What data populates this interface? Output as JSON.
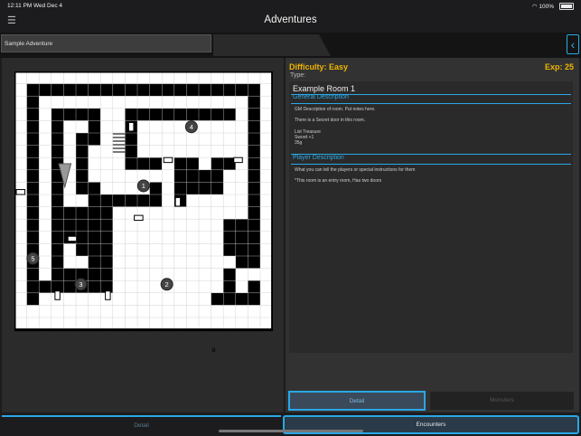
{
  "status": {
    "time": "12:11 PM",
    "date": "Wed Dec 4",
    "battery": "100%"
  },
  "nav": {
    "title": "Adventures",
    "menu_icon": "hamburger-menu-icon",
    "back_icon": "chevron-left-icon"
  },
  "adventure": {
    "name": "Sample Adventure"
  },
  "room": {
    "difficulty": "Difficulty: Easy",
    "exp": "Exp: 25",
    "type": "Type:",
    "name": "Example Room 1",
    "general_heading": "General Description",
    "general_lines": [
      "GM Description of room. Put notes here.",
      "There is a Secret door in this room.",
      "List Treasure",
      "Sword +1",
      "35g"
    ],
    "player_heading": "Player Description",
    "player_lines": [
      "What you can tell the players or special instructions for them",
      "*This room is an entry room, Has two doors"
    ]
  },
  "map": {
    "room_markers": [
      "1",
      "2",
      "3",
      "4",
      "5"
    ],
    "letter_marker": "a"
  },
  "tabs": {
    "inner_detail": "Detail",
    "inner_monsters": "Monsters",
    "bottom_detail": "Detail",
    "bottom_encounters": "Encounters"
  },
  "colors": {
    "accent": "#29a8e6",
    "highlight": "#f0b400"
  }
}
